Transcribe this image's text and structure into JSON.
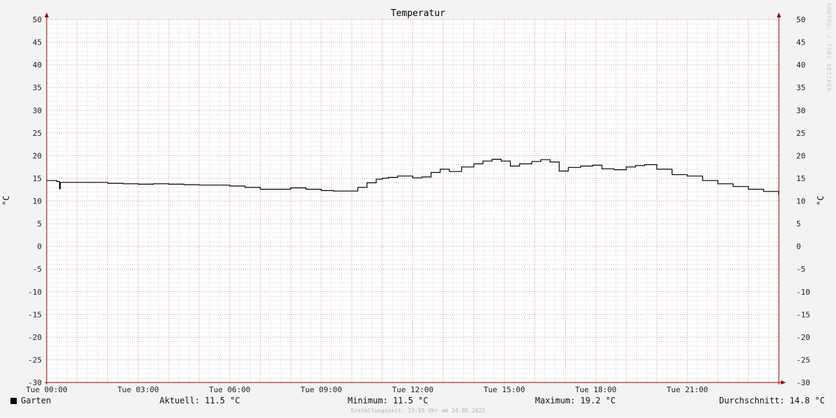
{
  "chart_data": {
    "type": "line",
    "title": "Temperatur",
    "ylabel": "°C",
    "ylabel_right": "°C",
    "ylim": [
      -30,
      50
    ],
    "yticks": [
      50,
      45,
      40,
      35,
      30,
      25,
      20,
      15,
      10,
      5,
      0,
      -5,
      -10,
      -15,
      -20,
      -25,
      -30
    ],
    "xlim": [
      0,
      24
    ],
    "xtick_hours": [
      0,
      3,
      6,
      9,
      12,
      15,
      18,
      21
    ],
    "xtick_labels": [
      "Tue 00:00",
      "Tue 03:00",
      "Tue 06:00",
      "Tue 09:00",
      "Tue 12:00",
      "Tue 15:00",
      "Tue 18:00",
      "Tue 21:00"
    ],
    "grid": true,
    "line_color": "#000000",
    "grid_major_color": "#e08a8a",
    "grid_minor_color": "#cfcfcf",
    "series": [
      {
        "name": "Garten",
        "x": [
          0,
          0.33,
          0.4,
          0.42,
          0.45,
          0.5,
          1.0,
          1.5,
          2.0,
          2.5,
          3.0,
          3.5,
          4.0,
          4.5,
          5.0,
          5.5,
          6.0,
          6.5,
          7.0,
          7.5,
          8.0,
          8.5,
          9.0,
          9.4,
          9.8,
          10.2,
          10.5,
          10.8,
          11.0,
          11.2,
          11.5,
          12.0,
          12.3,
          12.6,
          12.9,
          13.2,
          13.6,
          14.0,
          14.3,
          14.6,
          14.9,
          15.2,
          15.5,
          15.9,
          16.2,
          16.5,
          16.8,
          17.1,
          17.5,
          17.9,
          18.2,
          18.6,
          19.0,
          19.3,
          19.6,
          20.0,
          20.5,
          21.0,
          21.5,
          22.0,
          22.5,
          23.0,
          23.5,
          23.99
        ],
        "y": [
          14.5,
          14.3,
          14.3,
          12.7,
          14.1,
          14.1,
          14.1,
          14.1,
          13.9,
          13.8,
          13.7,
          13.8,
          13.7,
          13.6,
          13.5,
          13.5,
          13.3,
          13.0,
          12.6,
          12.6,
          12.9,
          12.6,
          12.3,
          12.2,
          12.2,
          13.0,
          14.0,
          14.8,
          15.0,
          15.2,
          15.5,
          15.1,
          15.3,
          16.3,
          17.0,
          16.5,
          17.5,
          18.2,
          18.8,
          19.2,
          18.8,
          17.7,
          18.2,
          18.7,
          19.1,
          18.6,
          16.6,
          17.4,
          17.7,
          17.9,
          17.1,
          16.9,
          17.5,
          17.8,
          18.0,
          17.0,
          15.8,
          15.5,
          14.5,
          13.8,
          13.2,
          12.6,
          12.1,
          11.5
        ]
      }
    ]
  },
  "legend": {
    "name": "Garten"
  },
  "stats": {
    "current": "Aktuell: 11.5 °C",
    "min": "Minimum: 11.5 °C",
    "max": "Maximum: 19.2 °C",
    "avg": "Durchschnitt: 14.8 °C"
  },
  "footer": {
    "created": "Erstellungszeit: 23:55 Uhr am 24.05.2022"
  },
  "watermark": "RRDTOOL / TOBI OETIKER"
}
